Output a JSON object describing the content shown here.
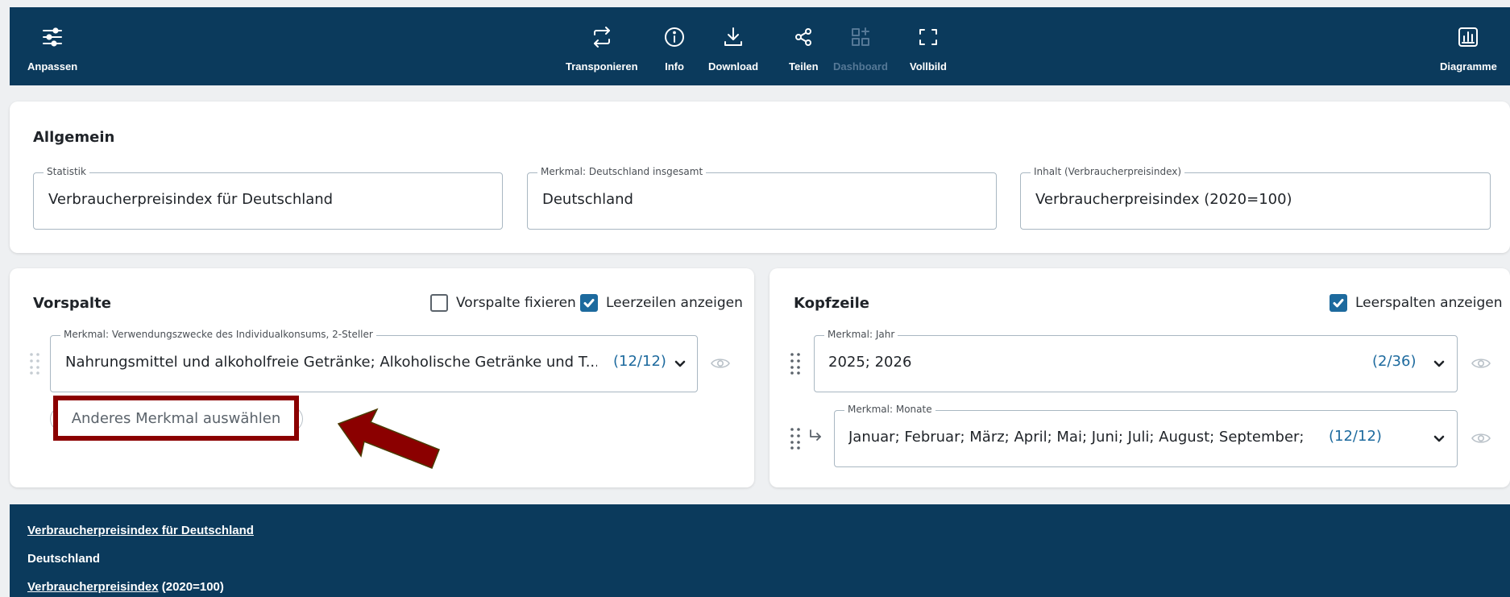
{
  "toolbar": {
    "left": {
      "label": "Anpassen",
      "icon": "sliders-icon"
    },
    "center": [
      {
        "label": "Transponieren",
        "icon": "transpose-icon",
        "enabled": true
      },
      {
        "label": "Info",
        "icon": "info-icon",
        "enabled": true
      },
      {
        "label": "Download",
        "icon": "download-icon",
        "enabled": true
      },
      {
        "label": "Teilen",
        "icon": "share-icon",
        "enabled": true
      },
      {
        "label": "Dashboard",
        "icon": "dashboard-icon",
        "enabled": false
      },
      {
        "label": "Vollbild",
        "icon": "fullscreen-icon",
        "enabled": true
      }
    ],
    "right": {
      "label": "Diagramme",
      "icon": "chart-icon"
    }
  },
  "allgemein": {
    "title": "Allgemein",
    "fields": [
      {
        "legend": "Statistik",
        "value": "Verbraucherpreisindex für Deutschland"
      },
      {
        "legend": "Merkmal: Deutschland insgesamt",
        "value": "Deutschland"
      },
      {
        "legend": "Inhalt (Verbraucherpreisindex)",
        "value": "Verbraucherpreisindex (2020=100)"
      }
    ]
  },
  "vorspalte": {
    "title": "Vorspalte",
    "fix_label": "Vorspalte fixieren",
    "fix_checked": false,
    "empty_rows_label": "Leerzeilen anzeigen",
    "empty_rows_checked": true,
    "field": {
      "legend": "Merkmal: Verwendungszwecke des Individualkonsums, 2-Steller",
      "value": "Nahrungsmittel und alkoholfreie Getränke; Alkoholische Getränke und T...",
      "count": "(12/12)"
    },
    "other_button": "Anderes Merkmal auswählen"
  },
  "kopfzeile": {
    "title": "Kopfzeile",
    "empty_cols_label": "Leerspalten anzeigen",
    "empty_cols_checked": true,
    "fields": [
      {
        "legend": "Merkmal: Jahr",
        "value": "2025; 2026",
        "count": "(2/36)"
      },
      {
        "legend": "Merkmal: Monate",
        "value": "Januar; Februar; März; April; Mai; Juni; Juli; August; September; Oktob...",
        "count": "(12/12)"
      }
    ]
  },
  "footer": {
    "line1": "Verbraucherpreisindex für Deutschland",
    "line2": "Deutschland",
    "line3_link": "Verbraucherpreisindex",
    "line3_rest": " (2020=100)"
  },
  "colors": {
    "navy": "#0b3a5c",
    "accent": "#1d6a9e",
    "highlight": "#8b0000"
  }
}
